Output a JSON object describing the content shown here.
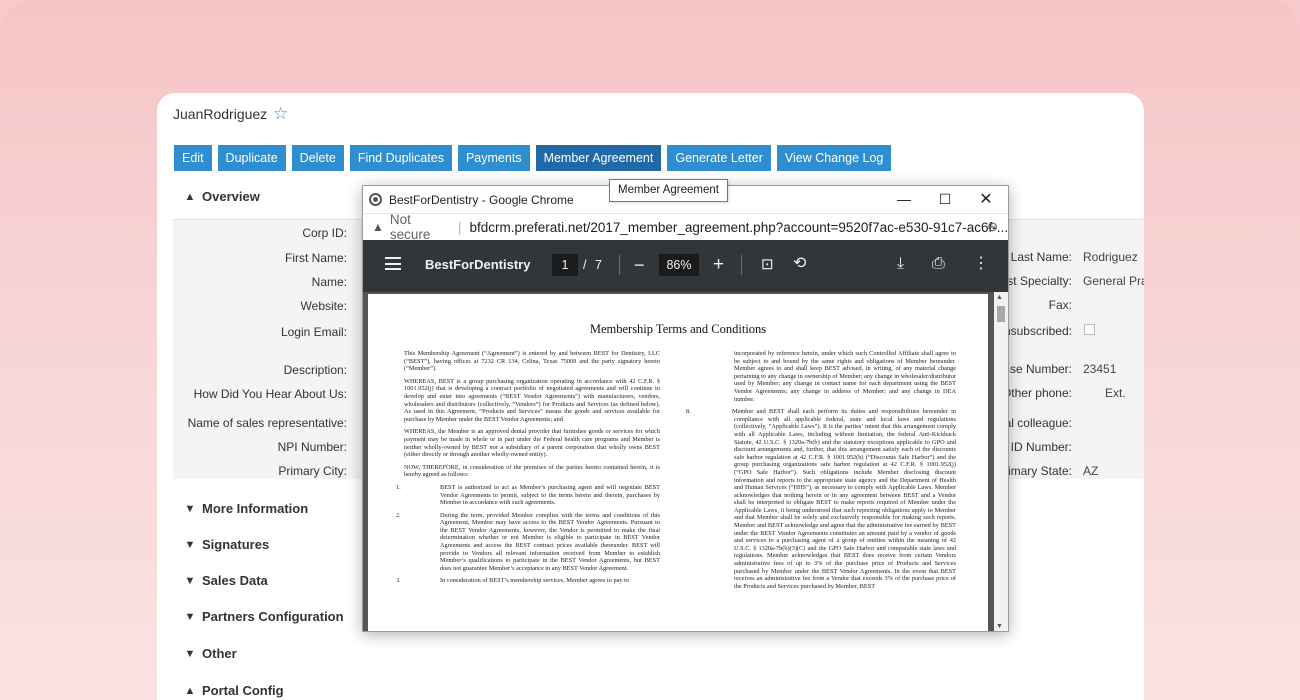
{
  "record": {
    "title": "JuanRodriguez"
  },
  "actions": [
    {
      "label": "Edit",
      "active": false
    },
    {
      "label": "Duplicate",
      "active": false
    },
    {
      "label": "Delete",
      "active": false
    },
    {
      "label": "Find Duplicates",
      "active": false
    },
    {
      "label": "Payments",
      "active": false
    },
    {
      "label": "Member Agreement",
      "active": true
    },
    {
      "label": "Generate Letter",
      "active": false
    },
    {
      "label": "View Change Log",
      "active": false
    }
  ],
  "tooltip": "Member Agreement",
  "sections": {
    "overview": "Overview",
    "more_information": "More Information",
    "signatures": "Signatures",
    "sales_data": "Sales Data",
    "partners_configuration": "Partners Configuration",
    "other": "Other",
    "portal_config": "Portal Config"
  },
  "left_fields": [
    {
      "label": "Corp ID:"
    },
    {
      "label": "First Name:"
    },
    {
      "label": "Name:"
    },
    {
      "label": "Website:"
    },
    {
      "label": "Login Email:"
    },
    {
      "label": "Description:"
    },
    {
      "label": "How Did You Hear About Us:"
    },
    {
      "label": "Name of sales representative:"
    },
    {
      "label": "NPI Number:"
    },
    {
      "label": "Primary City:"
    }
  ],
  "right_fields": [
    {
      "label": "Last Name:",
      "value": "Rodriguez"
    },
    {
      "label": "tist Specialty:",
      "value": "General Prac"
    },
    {
      "label": "Fax:",
      "value": ""
    },
    {
      "label": "Jnsubscribed:",
      "value": ""
    },
    {
      "label": "ense Number:",
      "value": "23451"
    },
    {
      "label": "Other phone:",
      "value": "Ext."
    },
    {
      "label": "tal colleague:",
      "value": ""
    },
    {
      "label": "x ID Number:",
      "value": ""
    },
    {
      "label": "Primary State:",
      "value": "AZ"
    }
  ],
  "popup": {
    "window_title": "BestForDentistry - Google Chrome",
    "not_secure": "Not secure",
    "url": "bfdcrm.preferati.net/2017_member_agreement.php?account=9520f7ac-e530-91c7-ac6f-...",
    "pdf_title": "BestForDentistry",
    "current_page": "1",
    "page_sep": "/",
    "total_pages": "7",
    "zoom": "86%",
    "doc_heading": "Membership Terms and Conditions",
    "left_column": [
      "This Membership Agreement (“Agreement”) is entered by and between BEST for Dentistry, LLC (“BEST”), having offices at 7232 CR 134, Celina, Texas 75009 and the party signatory hereto (“Member”).",
      "WHEREAS, BEST is a group purchasing organization operating in accordance with 42 C.F.R. § 1001.952(j) that is developing a contract portfolio of negotiated agreements and will continue to develop and enter into agreements (“BEST Vendor Agreements”) with manufacturers, vendors, wholesalers and distributors (collectively, “Vendors”) for Products and Services (as defined below). As used in this Agreement, “Products and Services” means the goods and services available for purchase by Member under the BEST Vendor Agreements; and",
      "WHEREAS, the Member is an approved dental provider that furnishes goods or services for which payment may be made in whole or in part under the Federal health care programs and Member is neither wholly-owned by BEST nor a subsidiary of a parent corporation that wholly owns BEST (either directly or through another wholly-owned entity).",
      "NOW, THEREFORE, in consideration of the premises of the parties hereto contained herein, it is hereby agreed as follows:"
    ],
    "left_items": [
      {
        "num": "1.",
        "text": "BEST is authorized to act as Member’s purchasing agent and will negotiate BEST Vendor Agreements to permit, subject to the terms herein and therein, purchases by Member in accordance with such agreements."
      },
      {
        "num": "2.",
        "text": "During the term, provided Member complies with the terms and conditions of this Agreement, Member may have access to the BEST Vendor Agreements. Pursuant to the BEST Vendor Agreements, however, the Vendor is permitted to make the final determination whether or not Member is eligible to participate in BEST Vendor Agreements and access the BEST contract prices available thereunder. BEST will provide to Vendors all relevant information received from Member to establish Member’s qualifications to participate in the BEST Vendor Agreements, but BEST does not guarantee Member’s acceptance in any BEST Vendor Agreement."
      },
      {
        "num": "3.",
        "text": "In consideration of BEST’s membership services, Member agrees to pay to"
      }
    ],
    "right_column": "incorporated by reference herein, under which such Controlled Affiliate shall agree to be subject to and bound by the same rights and obligations of Member hereunder. Member agrees to and shall keep BEST advised, in writing, of any material change pertaining to any change in ownership of Member; any change in wholesaler/distributor used by Member; any change in contact name for each department using the BEST Vendor Agreements; any change in address of Member; and any change in DEA number.",
    "right_items": [
      {
        "num": "8.",
        "text": "Member and BEST shall each perform its duties and responsibilities hereunder in compliance with all applicable federal, state and local laws and regulations (collectively, “Applicable Laws”). It is the parties’ intent that this arrangement comply with all Applicable Laws, including without limitation, the federal Anti-Kickback Statute, 42 U.S.C. § 1320a-7b(b) and the statutory exceptions applicable to GPO and discount arrangements and, further, that this arrangement satisfy each of the discounts safe harbor regulation at 42 C.F.R. § 1001.952(h) (“Discounts Safe Harbor”) and the group purchasing organizations safe harbor regulation at 42 C.F.R. § 1001.952(j) (“GPO Safe Harbor”). Such obligations include Member disclosing discount information and reports to the appropriate state agency and the Department of Health and Human Services (“HHS”), as necessary to comply with Applicable Laws. Member acknowledges that nothing herein or in any agreement between BEST and a Vendor shall be interpreted to obligate BEST to make reports required of Member under the Applicable Laws, it being understood that such reporting obligations apply to Member and that Member shall be solely and exclusively responsible for making such reports. Member and BEST acknowledge and agree that the administrative fee earned by BEST under the BEST Vendor Agreements constitutes an amount paid by a vendor of goods and services to a purchasing agent of a group of entities within the meaning of 42 U.S.C. § 1320a-7b(b)(3)(C) and the GPO Safe Harbor and comparable state laws and regulations. Member acknowledges that BEST does receive from certain Vendors administrative fees of up to 3% of the purchase price of Products and Services purchased by Member under the BEST Vendor Agreements. In the event that BEST receives an administrative fee from a Vendor that exceeds 3% of the purchase price of the Products and Services purchased by Member, BEST"
      }
    ]
  }
}
